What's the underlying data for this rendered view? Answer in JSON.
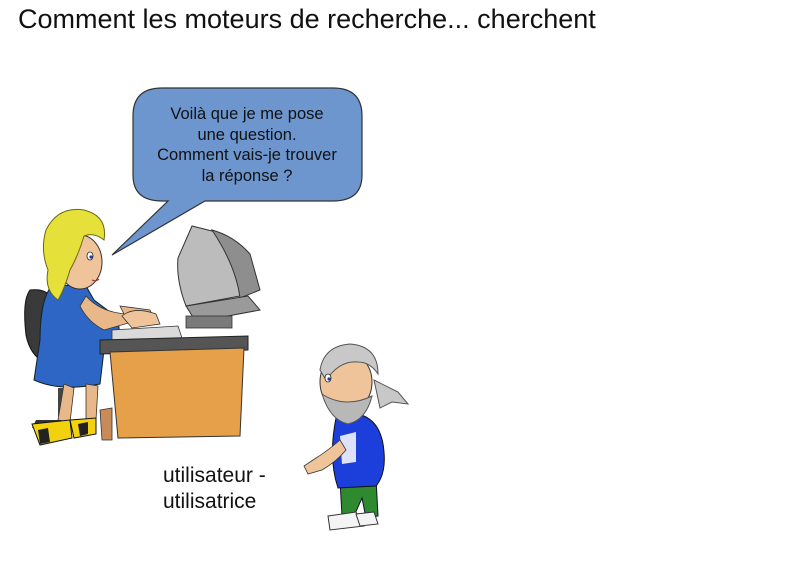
{
  "slide": {
    "title": "Comment les moteurs de recherche... cherchent",
    "bubble_lines": [
      "Voilà que je me pose",
      "une question.",
      "Comment vais-je trouver",
      "la réponse ?"
    ],
    "caption_lines": [
      "utilisateur -",
      "utilisatrice"
    ]
  },
  "colors": {
    "bubble_fill": "#6d96cf",
    "desk": "#e6a04a",
    "dress": "#2d66c4",
    "hair": "#e6e03a",
    "monitor": "#bcbcbc",
    "shirt": "#1c3fdc",
    "pants": "#2f8a2f"
  },
  "icons": [
    "woman-at-computer-illustration",
    "bearded-man-illustration",
    "speech-bubble"
  ]
}
